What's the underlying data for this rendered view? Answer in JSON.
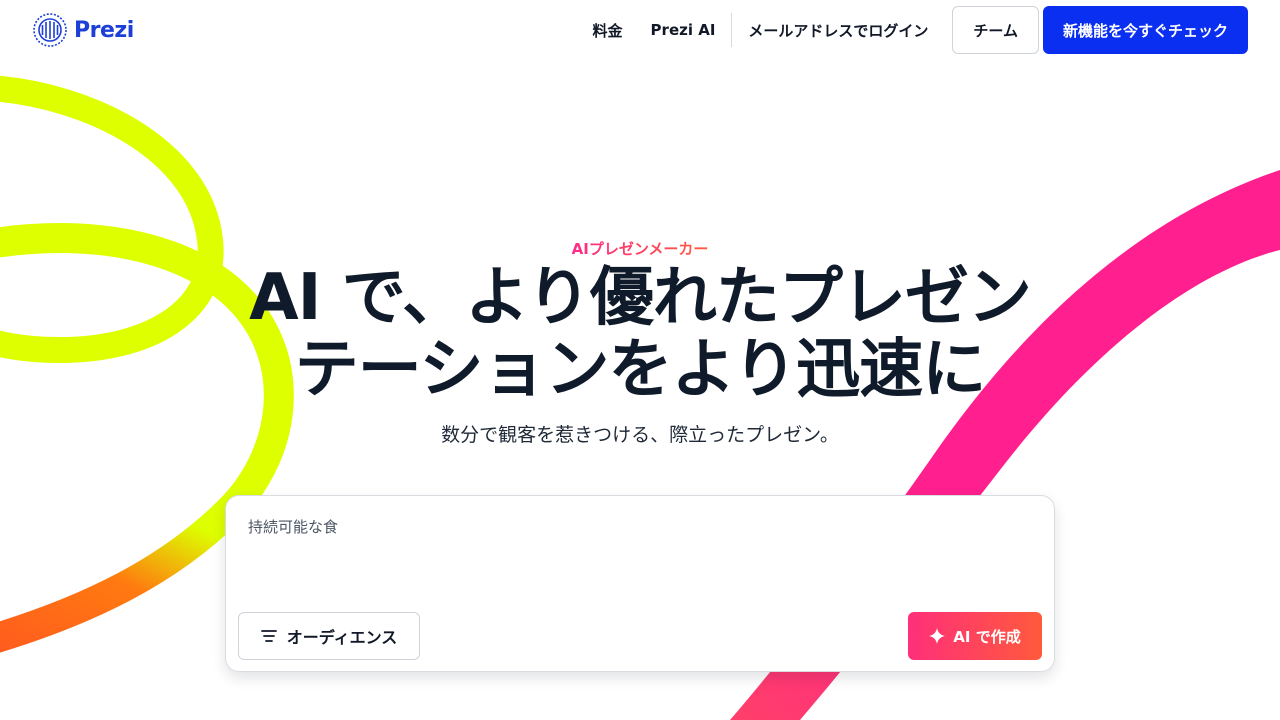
{
  "brand": {
    "name": "Prezi",
    "color": "#1b3fd8"
  },
  "nav": {
    "pricing": "料金",
    "prezi_ai": "Prezi AI",
    "login": "メールアドレスでログイン",
    "team": "チーム",
    "cta": "新機能を今すぐチェック",
    "cta_color": "#0b2ff0"
  },
  "hero": {
    "eyebrow": "AIプレゼンメーカー",
    "headline": "AI で、より優れたプレゼンテーションをより迅速に",
    "subline": "数分で観客を惹きつける、際立ったプレゼン。"
  },
  "prompt": {
    "value": "持続可能な食",
    "audience_label": "オーディエンス",
    "create_label": "AI で作成"
  },
  "colors": {
    "yellow_ribbon": "#ddff00",
    "pink_ribbon": "#ff1f8e",
    "orange_ribbon": "#ff5a1f"
  },
  "icons": {
    "logo": "prezi-logo-icon",
    "filter": "filter-lines-icon",
    "sparkle": "sparkle-icon"
  }
}
